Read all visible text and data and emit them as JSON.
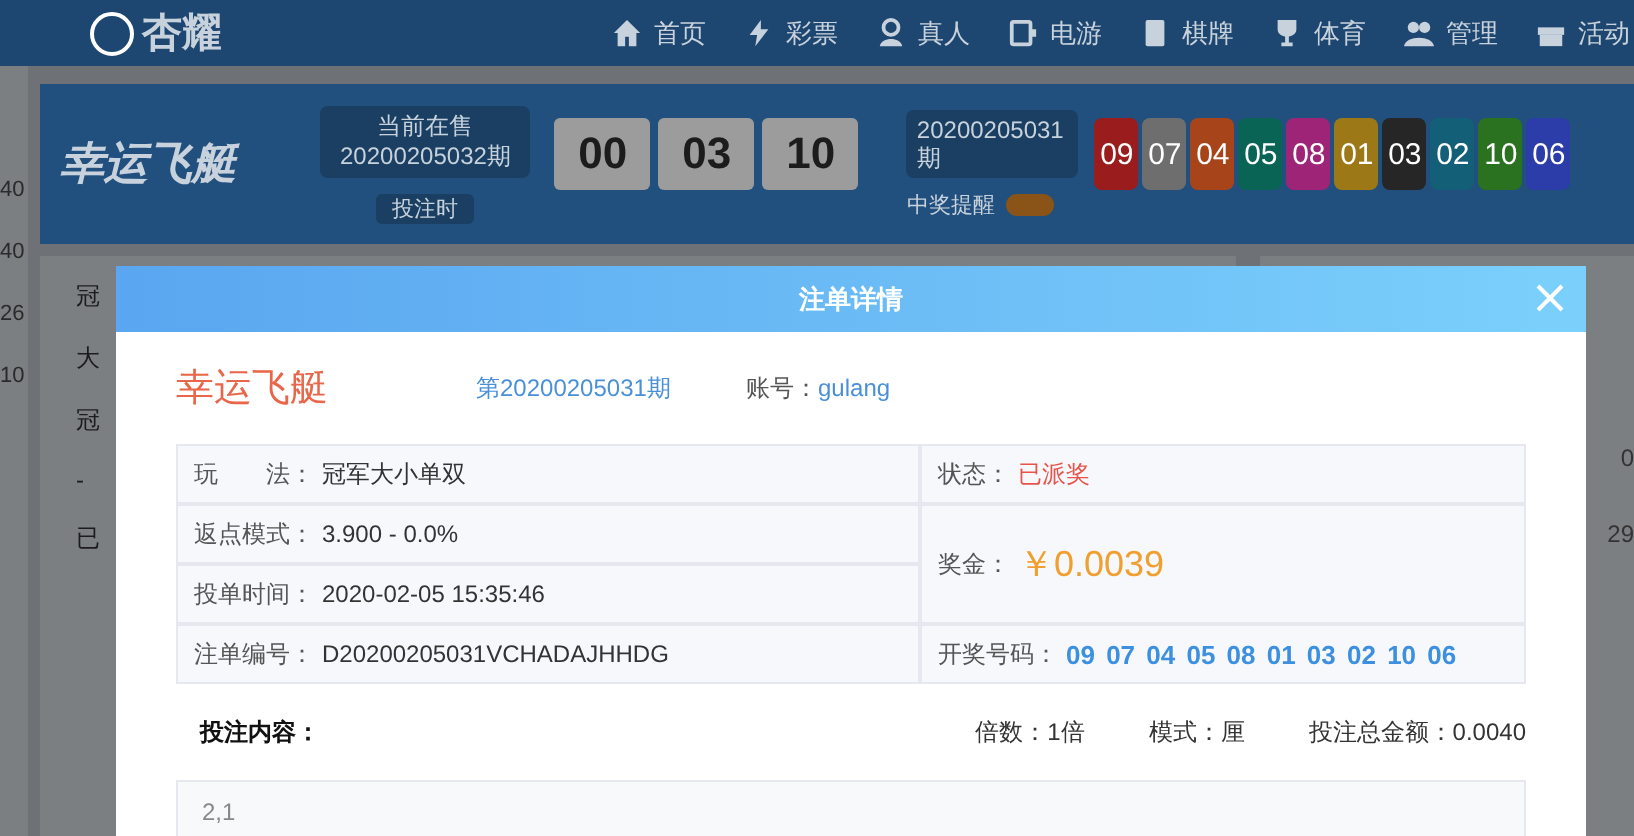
{
  "nav": {
    "logo": "杏耀",
    "items": [
      {
        "label": "首页"
      },
      {
        "label": "彩票"
      },
      {
        "label": "真人"
      },
      {
        "label": "电游"
      },
      {
        "label": "棋牌"
      },
      {
        "label": "体育"
      },
      {
        "label": "管理"
      },
      {
        "label": "活动"
      }
    ]
  },
  "left_strip": [
    "40",
    "40",
    "26",
    "10"
  ],
  "lottery_header": {
    "logo": "幸运飞艇",
    "current_sale": "当前在售",
    "current_period": "20200205032期",
    "countdown_label": "投注时",
    "countdown": [
      "00",
      "03",
      "10"
    ],
    "last_period": "20200205031期",
    "win_alert_label": "中奖提醒",
    "win_alert_on": true,
    "balls": [
      {
        "number": "09",
        "color": "#9a1c1c"
      },
      {
        "number": "07",
        "color": "#6e6e6e"
      },
      {
        "number": "04",
        "color": "#a8441a"
      },
      {
        "number": "05",
        "color": "#0a6456"
      },
      {
        "number": "08",
        "color": "#9e2478"
      },
      {
        "number": "01",
        "color": "#9c7816"
      },
      {
        "number": "03",
        "color": "#262626"
      },
      {
        "number": "02",
        "color": "#145f78"
      },
      {
        "number": "10",
        "color": "#2a7220"
      },
      {
        "number": "06",
        "color": "#2c3ca8"
      }
    ]
  },
  "main_panel": {
    "fragments": [
      "冠",
      "大",
      "冠",
      "-",
      "已"
    ]
  },
  "right_panel": {
    "fragments": [
      "0",
      "29"
    ]
  },
  "modal": {
    "title": "注单详情",
    "game": "幸运飞艇",
    "period": "第20200205031期",
    "account_label": "账号：",
    "account": "gulang",
    "play_label": "玩　　法：",
    "play": "冠军大小单双",
    "rebate_label": "返点模式：",
    "rebate": "3.900 - 0.0%",
    "time_label": "投单时间：",
    "time": "2020-02-05 15:35:46",
    "order_label": "注单编号：",
    "order": "D20200205031VCHADAJHHDG",
    "status_label": "状态：",
    "status": "已派奖",
    "prize_label": "奖金：",
    "prize": "￥0.0039",
    "draw_label": "开奖号码：",
    "draw": "09 07 04 05 08 01 03 02 10 06",
    "content_label": "投注内容：",
    "multiple": "倍数：1倍",
    "mode": "模式：厘",
    "total": "投注总金额：0.0040",
    "content": "2,1"
  }
}
